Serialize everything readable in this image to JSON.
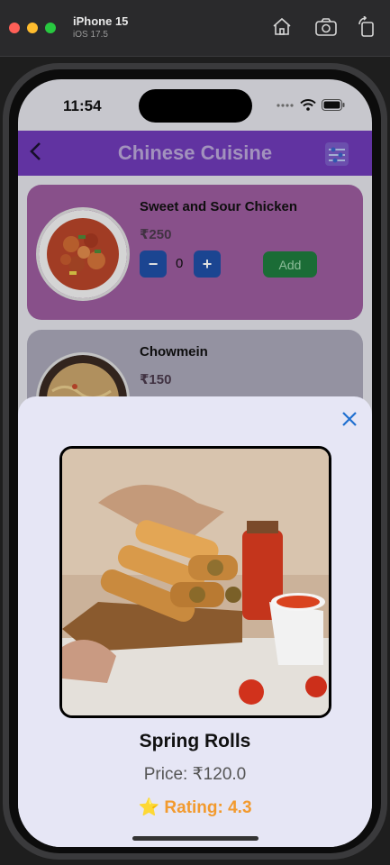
{
  "simulator": {
    "device": "iPhone 15",
    "os": "iOS 17.5",
    "toolbar_icons": [
      "home-icon",
      "screenshot-icon",
      "rotate-icon"
    ]
  },
  "status_bar": {
    "time": "11:54"
  },
  "header": {
    "title": "Chinese Cuisine",
    "color": "#6f3bb8"
  },
  "menu_items": [
    {
      "name": "Sweet and Sour Chicken",
      "price": "₹250",
      "quantity": "0",
      "minus": "−",
      "plus": "+",
      "add_label": "Add"
    },
    {
      "name": "Chowmein",
      "price": "₹150"
    }
  ],
  "detail_sheet": {
    "name": "Spring Rolls",
    "price": "Price: ₹120.0",
    "rating": "⭐ Rating: 4.3",
    "accent": "#f29a2e"
  }
}
